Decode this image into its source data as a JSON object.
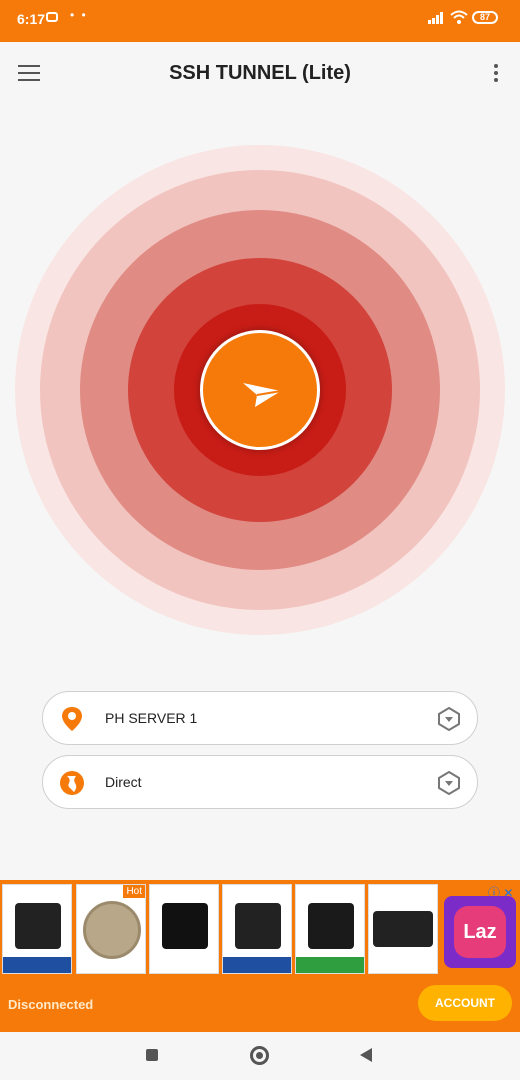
{
  "status_bar": {
    "time": "6:17",
    "battery": "87"
  },
  "app": {
    "title": "SSH TUNNEL (Lite)"
  },
  "server": {
    "label": "PH SERVER 1"
  },
  "mode": {
    "label": "Direct"
  },
  "ads": {
    "hot": "Hot",
    "laz": "Laz"
  },
  "footer": {
    "status": "Disconnected",
    "account_label": "ACCOUNT"
  },
  "colors": {
    "accent": "#f57a0a",
    "ring_core": "#c81d16"
  }
}
